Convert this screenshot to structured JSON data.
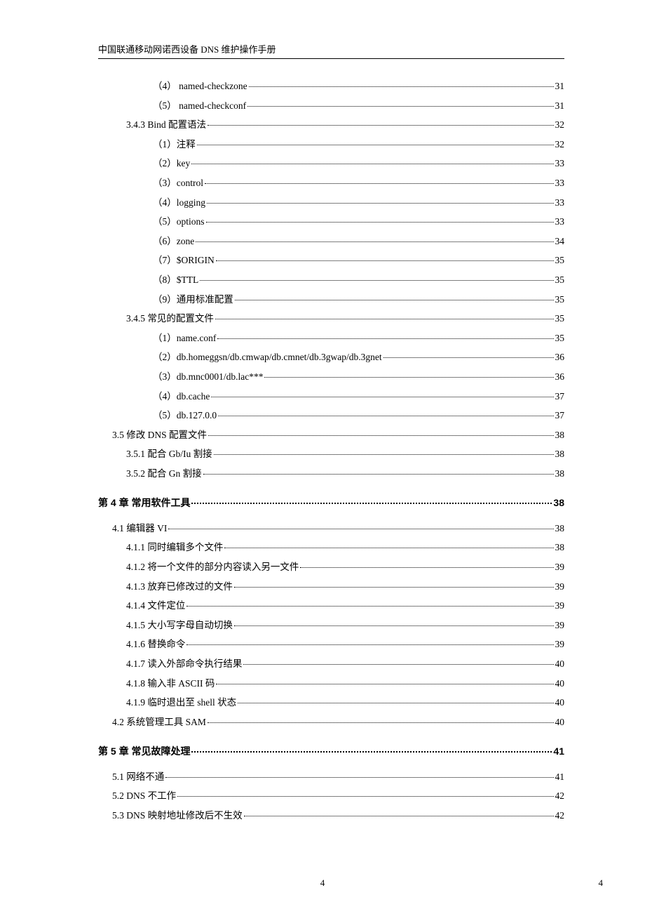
{
  "header": {
    "title": "中国联通移动网诺西设备 DNS 维护操作手册"
  },
  "toc": {
    "initial": [
      {
        "label": "（4） named-checkzone",
        "page": "31",
        "indent": 4
      },
      {
        "label": "（5） named-checkconf",
        "page": "31",
        "indent": 4
      },
      {
        "label": "3.4.3 Bind 配置语法",
        "page": "32",
        "indent": 2
      },
      {
        "label": "（1）注释",
        "page": "32",
        "indent": 4
      },
      {
        "label": "（2）key",
        "page": "33",
        "indent": 4
      },
      {
        "label": "（3）control",
        "page": "33",
        "indent": 4
      },
      {
        "label": "（4）logging",
        "page": "33",
        "indent": 4
      },
      {
        "label": "（5）options",
        "page": "33",
        "indent": 4
      },
      {
        "label": "（6）zone",
        "page": "34",
        "indent": 4
      },
      {
        "label": "（7）$ORIGIN",
        "page": "35",
        "indent": 4
      },
      {
        "label": "（8）$TTL",
        "page": "35",
        "indent": 4
      },
      {
        "label": "（9）通用标准配置",
        "page": "35",
        "indent": 4
      },
      {
        "label": "3.4.5 常见的配置文件",
        "page": "35",
        "indent": 2
      },
      {
        "label": "（1）name.conf",
        "page": "35",
        "indent": 4
      },
      {
        "label": "（2）db.homeggsn/db.cmwap/db.cmnet/db.3gwap/db.3gnet",
        "page": "36",
        "indent": 4
      },
      {
        "label": "（3）db.mnc0001/db.lac***",
        "page": "36",
        "indent": 4
      },
      {
        "label": "（4）db.cache",
        "page": "37",
        "indent": 4
      },
      {
        "label": "（5）db.127.0.0",
        "page": "37",
        "indent": 4
      },
      {
        "label": "3.5 修改 DNS 配置文件",
        "page": "38",
        "indent": 1
      },
      {
        "label": "3.5.1 配合 Gb/Iu 割接",
        "page": "38",
        "indent": 2
      },
      {
        "label": "3.5.2 配合 Gn 割接",
        "page": "38",
        "indent": 2
      }
    ],
    "chapter4": {
      "label": "第 4 章 常用软件工具",
      "page": "38"
    },
    "block4": [
      {
        "label": "4.1 编辑器 VI",
        "page": "38",
        "indent": 1
      },
      {
        "label": "4.1.1 同时编辑多个文件",
        "page": "38",
        "indent": 2
      },
      {
        "label": "4.1.2 将一个文件的部分内容读入另一文件",
        "page": "39",
        "indent": 2
      },
      {
        "label": "4.1.3 放弃已修改过的文件",
        "page": "39",
        "indent": 2
      },
      {
        "label": "4.1.4 文件定位",
        "page": "39",
        "indent": 2
      },
      {
        "label": "4.1.5 大小写字母自动切换",
        "page": "39",
        "indent": 2
      },
      {
        "label": "4.1.6 替换命令",
        "page": "39",
        "indent": 2
      },
      {
        "label": "4.1.7 读入外部命令执行结果",
        "page": "40",
        "indent": 2
      },
      {
        "label": "4.1.8 输入非 ASCII 码",
        "page": "40",
        "indent": 2
      },
      {
        "label": "4.1.9 临时退出至 shell 状态",
        "page": "40",
        "indent": 2
      },
      {
        "label": "4.2 系统管理工具 SAM",
        "page": "40",
        "indent": 1
      }
    ],
    "chapter5": {
      "label": "第 5 章 常见故障处理",
      "page": "41"
    },
    "block5": [
      {
        "label": "5.1 网络不通",
        "page": "41",
        "indent": 1
      },
      {
        "label": "5.2 DNS 不工作",
        "page": "42",
        "indent": 1
      },
      {
        "label": "5.3 DNS 映射地址修改后不生效",
        "page": "42",
        "indent": 1
      }
    ]
  },
  "footer": {
    "center": "4",
    "right": "4"
  }
}
